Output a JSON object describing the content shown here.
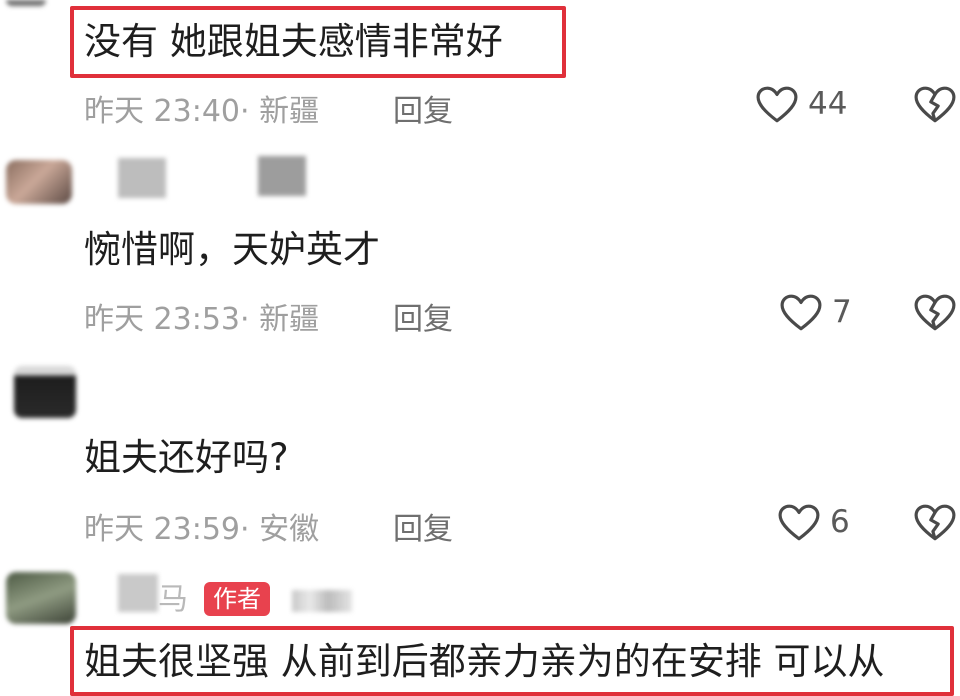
{
  "comments": [
    {
      "text": "没有 她跟姐夫感情非常好",
      "meta": "昨天 23:40· 新疆",
      "reply": "回复",
      "likes": "44",
      "highlighted": true
    },
    {
      "text": "惋惜啊，天妒英才",
      "meta": "昨天 23:53· 新疆",
      "reply": "回复",
      "likes": "7"
    },
    {
      "text": "姐夫还好吗?",
      "meta": "昨天 23:59· 安徽",
      "reply": "回复",
      "likes": "6"
    },
    {
      "username_visible": "马",
      "author_tag": "作者",
      "text": "姐夫很坚强 从前到后都亲力亲为的在安排 可以从",
      "highlighted": true
    }
  ],
  "colors": {
    "highlight_border": "#e0303a",
    "author_tag_bg": "#e8424e",
    "meta_text": "#9f9f9f"
  },
  "icons": [
    "heart-icon",
    "broken-heart-icon"
  ]
}
